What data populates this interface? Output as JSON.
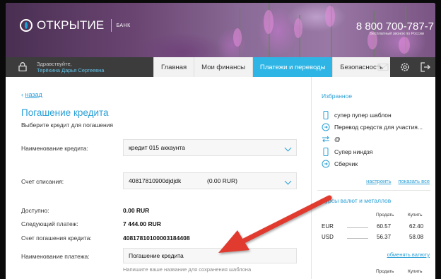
{
  "header": {
    "logo_text": "ОТКРЫТИЕ",
    "logo_sub": "БАНК",
    "phone": "8 800 700-787-7",
    "phone_sub": "Бесплатный звонок по России"
  },
  "nav": {
    "greeting": "Здравствуйте,",
    "user_name": "Терёхина Дарья Сергеевна",
    "tabs": [
      {
        "label": "Главная",
        "active": false
      },
      {
        "label": "Мои финансы",
        "active": false
      },
      {
        "label": "Платежи и переводы",
        "active": true
      },
      {
        "label": "Безопасность",
        "active": false
      }
    ],
    "icons": [
      "mail-icon",
      "gear-icon",
      "logout-icon"
    ]
  },
  "main": {
    "back_link": "назад",
    "title": "Погашение кредита",
    "subtitle": "Выберите кредит для погашения",
    "credit_name_label": "Наименование кредита:",
    "credit_name_value": "кредит 015 аккаунта",
    "debit_account_label": "Счет списания:",
    "debit_account_value": "40817810900djdjdk",
    "debit_account_balance": "(0.00   RUR)",
    "available_label": "Доступно:",
    "available_value": "0.00   RUR",
    "next_payment_label": "Следующий платеж:",
    "next_payment_value": "7 444.00 RUR",
    "repay_account_label": "Счет погашения кредита:",
    "repay_account_value": "40817810100003184408",
    "payment_name_label": "Наименование платежа:",
    "payment_name_value": "Погашение кредита",
    "payment_name_hint": "Напишите ваше название для сохранения шаблона"
  },
  "sidebar": {
    "favorites_title": "Избранное",
    "favorites": [
      {
        "label": "супер пупер шаблон",
        "icon": "phone-icon"
      },
      {
        "label": "Перевод средств для участия...",
        "icon": "coin-transfer-icon"
      },
      {
        "label": "@",
        "icon": "exchange-arrows-icon"
      },
      {
        "label": "Супер ниндзя",
        "icon": "phone-icon"
      },
      {
        "label": "Сберчик",
        "icon": "coin-transfer-icon"
      }
    ],
    "configure_link": "настроить",
    "show_all_link": "показать все",
    "rates_title": "Курсы валют и металлов",
    "sell_header": "Продать",
    "buy_header": "Купить",
    "rates": [
      {
        "currency": "EUR",
        "sell": "60.57",
        "buy": "62.40"
      },
      {
        "currency": "USD",
        "sell": "56.37",
        "buy": "58.08"
      }
    ],
    "change_currency_link": "обменять валюту",
    "sell_header_2": "Продать",
    "buy_header_2": "Купить"
  },
  "colors": {
    "accent": "#2eb5e5",
    "link": "#2a9fd6",
    "navbar": "#3c3c3c",
    "arrow": "#e03a2f"
  }
}
